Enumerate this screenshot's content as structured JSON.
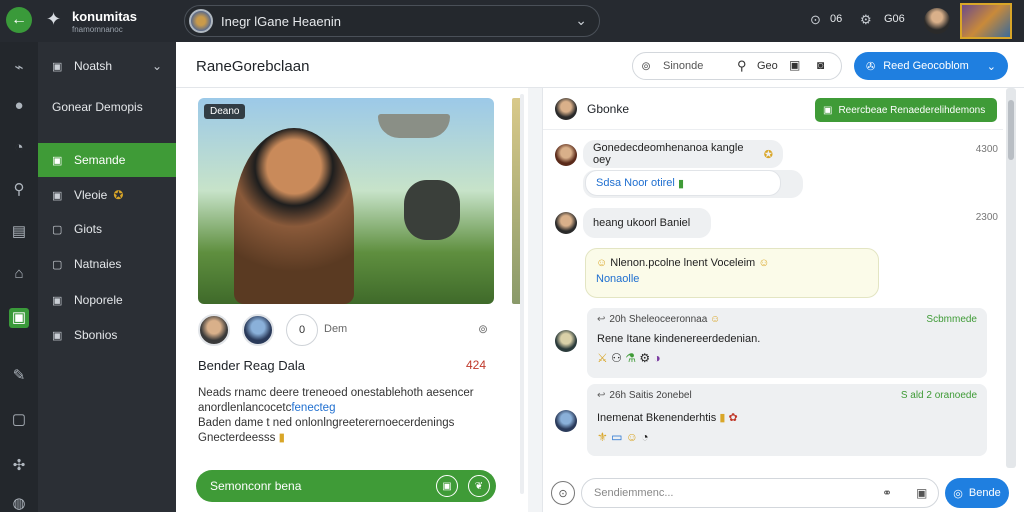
{
  "app": {
    "brand": "konumitas",
    "brand_sub": "fnamomnanoc",
    "search_text": "Inegr lGane Heaenin",
    "stat1": "06",
    "stat2": "G06"
  },
  "sidebar": {
    "items": [
      {
        "label": "Noatsh",
        "icon": "▣"
      },
      {
        "label": "Gonear Demopis",
        "icon": ""
      },
      {
        "label": "Semande",
        "icon": "▣"
      },
      {
        "label": "Vleoie",
        "icon": "▣",
        "badge": "✪"
      },
      {
        "label": "Giots",
        "icon": "▢"
      },
      {
        "label": "Natnaies",
        "icon": "▢"
      },
      {
        "label": "Noporele",
        "icon": "▣"
      },
      {
        "label": "Sbonios",
        "icon": "▣"
      }
    ]
  },
  "header": {
    "title": "RaneGorebclaan",
    "search_placeholder": "Sinonde",
    "search_label": "Geo",
    "primary_button": "Reed Geocoblom"
  },
  "post": {
    "image_tag": "Deano",
    "reaction_count": "0",
    "reaction_label": "Dem",
    "title": "Bender Reag Dala",
    "value": "424",
    "body_line1": "Neads rnamc deere treneoed onestablehoth aesencer",
    "body_line2_a": "anordlenlancocetc",
    "body_line2_link": "fenecteg",
    "body_line3": "Baden dame t ned onlonlngreeterernoecerdenings",
    "body_line4": "Gnecterdeesss",
    "action_button": "Semonconr bena"
  },
  "chat": {
    "head_name": "Gbonke",
    "head_button": "Reercbeae Renaederelihdemons",
    "messages": [
      {
        "text": "Gonedecdeomhenanoa kangle oey",
        "time": "4300"
      },
      {
        "text": "Sdsa Noor otirel",
        "time": ""
      },
      {
        "text": "heang ukoorl Baniel",
        "time": "2300"
      },
      {
        "text": "Nlenon.pcolne lnent Voceleim",
        "sub": "Nonaolle",
        "time": ""
      },
      {
        "meta": "20h Sheleoceeronnaa",
        "meta_right": "Scbmmede",
        "text": "Rene Itane kindenereerdedenian.",
        "time": ""
      },
      {
        "meta": "26h Saitis 2onebel",
        "meta_right": "S ald 2 oranoede",
        "text": "Inemenat Bkenenderhtis",
        "time": ""
      }
    ],
    "input_placeholder": "Sendiemmenc...",
    "send_label": "Bende"
  }
}
